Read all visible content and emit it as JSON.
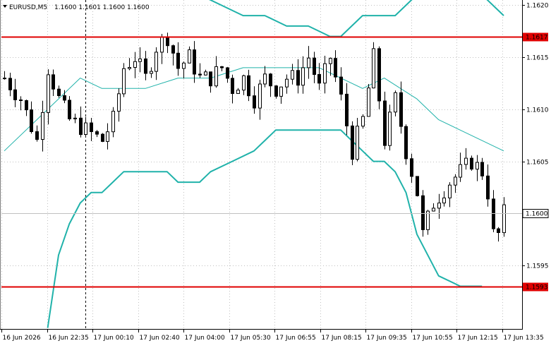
{
  "header": {
    "symbol": "EURUSD,M5",
    "ohlc": "1.1600 1.1601 1.1600 1.1600"
  },
  "colors": {
    "background": "#ffffff",
    "candle": "#000000",
    "bollinger": "#20b2aa",
    "level_line": "#e00000",
    "grid": "#c0c0c0",
    "current_price_line": "#c0c0c0"
  },
  "chart_data": {
    "type": "candlestick",
    "symbol": "EURUSD",
    "timeframe": "M5",
    "ohlc_header": {
      "open": 1.16,
      "high": 1.1601,
      "low": 1.16,
      "close": 1.16
    },
    "ylim": [
      1.1589,
      1.162
    ],
    "y_ticks": [
      "1.1620",
      "1.1615",
      "1.1610",
      "1.1605",
      "1.1600",
      "1.1595"
    ],
    "x_ticks": [
      "16 Jun 2026",
      "16 Jun 22:35",
      "17 Jun 00:10",
      "17 Jun 02:40",
      "17 Jun 04:00",
      "17 Jun 05:30",
      "17 Jun 06:55",
      "17 Jun 08:15",
      "17 Jun 09:35",
      "17 Jun 10:55",
      "17 Jun 12:15",
      "17 Jun 13:35"
    ],
    "horizontal_levels": [
      {
        "price": 1.1617,
        "label": "1.1617"
      },
      {
        "price": 1.1593,
        "label": "1.1593"
      }
    ],
    "current_price": {
      "price": 1.16,
      "label": "1.1600"
    },
    "close_path": [
      [
        0,
        1.1613
      ],
      [
        3,
        1.1611
      ],
      [
        6,
        1.1607
      ],
      [
        8,
        1.1614
      ],
      [
        10,
        1.1611
      ],
      [
        12,
        1.1609
      ],
      [
        15,
        1.1608
      ],
      [
        18,
        1.1607
      ],
      [
        20,
        1.1609
      ],
      [
        22,
        1.1614
      ],
      [
        24,
        1.1615
      ],
      [
        26,
        1.1613
      ],
      [
        28,
        1.1616
      ],
      [
        30,
        1.1617
      ],
      [
        32,
        1.1614
      ],
      [
        34,
        1.1615
      ],
      [
        36,
        1.1613
      ],
      [
        38,
        1.1613
      ],
      [
        40,
        1.1614
      ],
      [
        42,
        1.1612
      ],
      [
        44,
        1.1613
      ],
      [
        46,
        1.1611
      ],
      [
        48,
        1.1613
      ],
      [
        50,
        1.1612
      ],
      [
        52,
        1.1613
      ],
      [
        54,
        1.1613
      ],
      [
        56,
        1.1615
      ],
      [
        58,
        1.1612
      ],
      [
        60,
        1.1615
      ],
      [
        61,
        1.1613
      ],
      [
        62,
        1.1611
      ],
      [
        64,
        1.1606
      ],
      [
        66,
        1.1609
      ],
      [
        68,
        1.1615
      ],
      [
        70,
        1.1607
      ],
      [
        72,
        1.1611
      ],
      [
        74,
        1.1606
      ],
      [
        76,
        1.1602
      ],
      [
        77,
        1.1598
      ],
      [
        79,
        1.1601
      ],
      [
        82,
        1.1603
      ],
      [
        84,
        1.1604
      ],
      [
        86,
        1.1605
      ],
      [
        88,
        1.1604
      ],
      [
        89,
        1.1602
      ],
      [
        90,
        1.1598
      ],
      [
        91,
        1.1598
      ],
      [
        92,
        1.16
      ]
    ],
    "bollinger_upper": [
      [
        34,
        1.1622
      ],
      [
        36,
        1.1621
      ],
      [
        40,
        1.162
      ],
      [
        44,
        1.1619
      ],
      [
        48,
        1.1619
      ],
      [
        52,
        1.1618
      ],
      [
        56,
        1.1618
      ],
      [
        60,
        1.1617
      ],
      [
        62,
        1.1617
      ],
      [
        64,
        1.1618
      ],
      [
        66,
        1.1619
      ],
      [
        72,
        1.1619
      ],
      [
        74,
        1.162
      ],
      [
        76,
        1.1621
      ],
      [
        88,
        1.1621
      ],
      [
        90,
        1.162
      ],
      [
        92,
        1.1619
      ]
    ],
    "bollinger_middle": [
      [
        0,
        1.1606
      ],
      [
        6,
        1.1609
      ],
      [
        10,
        1.1611
      ],
      [
        14,
        1.1613
      ],
      [
        18,
        1.1612
      ],
      [
        26,
        1.1612
      ],
      [
        32,
        1.1613
      ],
      [
        38,
        1.1613
      ],
      [
        44,
        1.1614
      ],
      [
        48,
        1.1614
      ],
      [
        58,
        1.1614
      ],
      [
        62,
        1.1613
      ],
      [
        66,
        1.1612
      ],
      [
        70,
        1.1613
      ],
      [
        76,
        1.1611
      ],
      [
        80,
        1.1609
      ],
      [
        84,
        1.1608
      ],
      [
        88,
        1.1607
      ],
      [
        92,
        1.1606
      ]
    ],
    "bollinger_lower": [
      [
        8,
        1.1589
      ],
      [
        10,
        1.1596
      ],
      [
        12,
        1.1599
      ],
      [
        14,
        1.1601
      ],
      [
        16,
        1.1602
      ],
      [
        18,
        1.1602
      ],
      [
        20,
        1.1603
      ],
      [
        22,
        1.1604
      ],
      [
        24,
        1.1604
      ],
      [
        28,
        1.1604
      ],
      [
        30,
        1.1604
      ],
      [
        32,
        1.1603
      ],
      [
        34,
        1.1603
      ],
      [
        36,
        1.1603
      ],
      [
        38,
        1.1604
      ],
      [
        42,
        1.1605
      ],
      [
        46,
        1.1606
      ],
      [
        48,
        1.1607
      ],
      [
        50,
        1.1608
      ],
      [
        54,
        1.1608
      ],
      [
        58,
        1.1608
      ],
      [
        62,
        1.1608
      ],
      [
        64,
        1.1607
      ],
      [
        66,
        1.1606
      ],
      [
        68,
        1.1605
      ],
      [
        70,
        1.1605
      ],
      [
        72,
        1.1604
      ],
      [
        74,
        1.1602
      ],
      [
        76,
        1.1598
      ],
      [
        78,
        1.1596
      ],
      [
        80,
        1.1594
      ],
      [
        84,
        1.1593
      ],
      [
        86,
        1.1593
      ],
      [
        88,
        1.1593
      ]
    ],
    "x_index_range": [
      0,
      92
    ],
    "period_separator_index": 15
  }
}
